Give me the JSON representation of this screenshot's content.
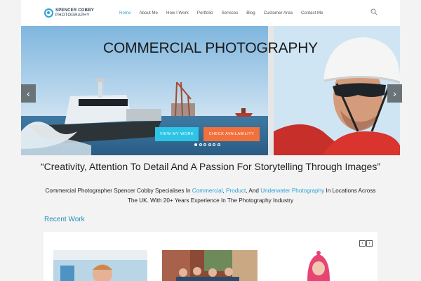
{
  "header": {
    "logo_line1": "SPENCER COBBY",
    "logo_line2": "PHOTOGRAPHY",
    "nav": [
      "Home",
      "About Me",
      "How I Work",
      "Portfolio",
      "Services",
      "Blog",
      "Customer Area",
      "Contact Me"
    ],
    "active_nav": "Home",
    "search_icon": "search-icon"
  },
  "hero": {
    "title": "COMMERCIAL PHOTOGRAPHY",
    "view_button": "VIEW MY WORK",
    "check_button": "CHECK AVAILABILITY",
    "prev_arrow": "‹",
    "next_arrow": "›",
    "slide_count": 6,
    "active_slide": 1
  },
  "quote": "“Creativity, Attention To Detail And A Passion For Storytelling Through Images”",
  "intro": {
    "part1": "Commercial Photographer Spencer Cobby Specialises In ",
    "link1": "Commercial",
    "sep1": ", ",
    "link2": "Product",
    "sep2": ", And  ",
    "link3": "Underwater Photography",
    "part2": " In Locations Across The UK. With 20+ Years Experience In The Photography Industry"
  },
  "recent": {
    "title": "Recent Work",
    "prev": "‹",
    "next": "›"
  },
  "colors": {
    "accent": "#2aa1d8",
    "view_button": "#2ec4e6",
    "check_button": "#f2703c"
  }
}
